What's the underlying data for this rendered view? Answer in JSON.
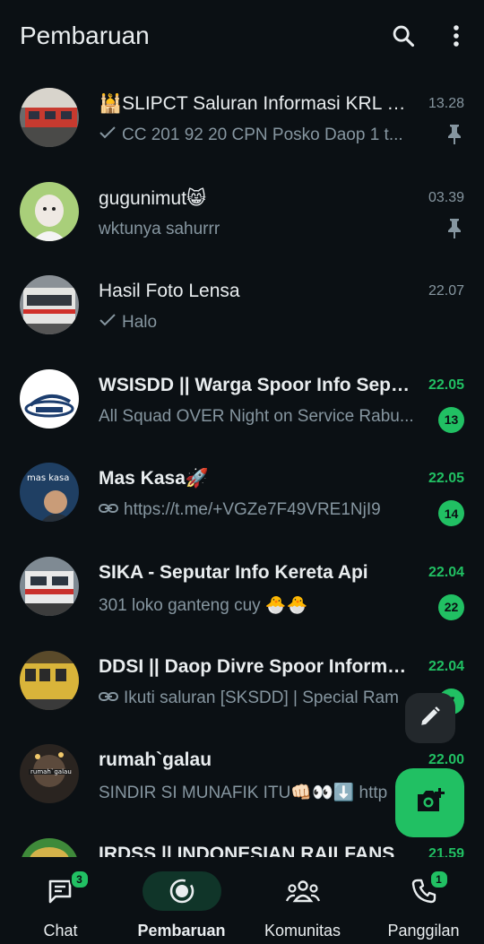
{
  "header": {
    "title": "Pembaruan",
    "search_icon": "search-icon",
    "menu_icon": "more-vert-icon"
  },
  "colors": {
    "background": "#0b1014",
    "accent": "#21c063",
    "muted": "#8696a0",
    "text": "#e9edef"
  },
  "channels": [
    {
      "name": "🕌SLIPCT Saluran Informasi KRL Commuter Line",
      "time": "13.28",
      "preview": "CC 201 92 20 CPN  Posko Daop 1 t...",
      "prefix": "check",
      "pinned": true,
      "unread": false,
      "badge": ""
    },
    {
      "name": "gugunimut😸",
      "time": "03.39",
      "preview": "wktunya sahurrr",
      "prefix": "",
      "pinned": true,
      "unread": false,
      "badge": ""
    },
    {
      "name": "Hasil Foto Lensa",
      "time": "22.07",
      "preview": "Halo",
      "prefix": "check",
      "pinned": false,
      "unread": false,
      "badge": ""
    },
    {
      "name": "WSISDD || Warga Spoor Info Seputar Daop Divre",
      "time": "22.05",
      "preview": "All Squad OVER Night on Service Rabu...",
      "prefix": "",
      "pinned": false,
      "unread": true,
      "badge": "13"
    },
    {
      "name": "Mas Kasa🚀",
      "time": "22.05",
      "preview": "https://t.me/+VGZe7F49VRE1NjI9",
      "prefix": "link",
      "pinned": false,
      "unread": true,
      "badge": "14"
    },
    {
      "name": "SIKA - Seputar Info Kereta Api",
      "time": "22.04",
      "preview": "301 loko ganteng cuy 🐣🐣",
      "prefix": "",
      "pinned": false,
      "unread": true,
      "badge": "22"
    },
    {
      "name": "DDSI || Daop Divre Spoor Information",
      "time": "22.04",
      "preview": "Ikuti saluran [SKSDD] | Special Ram",
      "prefix": "link",
      "pinned": false,
      "unread": true,
      "badge": "7"
    },
    {
      "name": "rumah`galau",
      "time": "22.00",
      "preview": "SINDIR SI MUNAFIK ITU👊🏻👀⬇️   http",
      "prefix": "",
      "pinned": false,
      "unread": true,
      "badge": ""
    },
    {
      "name": "IRDSS || INDONESIAN RAILFANS",
      "time": "21.59",
      "preview": "",
      "prefix": "",
      "pinned": false,
      "unread": true,
      "badge": ""
    }
  ],
  "fab": {
    "edit_icon": "pencil-icon",
    "camera_icon": "add-camera-icon"
  },
  "nav": [
    {
      "label": "Chat",
      "icon": "chat-icon",
      "badge": "3",
      "active": false
    },
    {
      "label": "Pembaruan",
      "icon": "status-updates-icon",
      "badge": "",
      "active": true
    },
    {
      "label": "Komunitas",
      "icon": "communities-icon",
      "badge": "",
      "active": false
    },
    {
      "label": "Panggilan",
      "icon": "phone-icon",
      "badge": "1",
      "active": false
    }
  ]
}
